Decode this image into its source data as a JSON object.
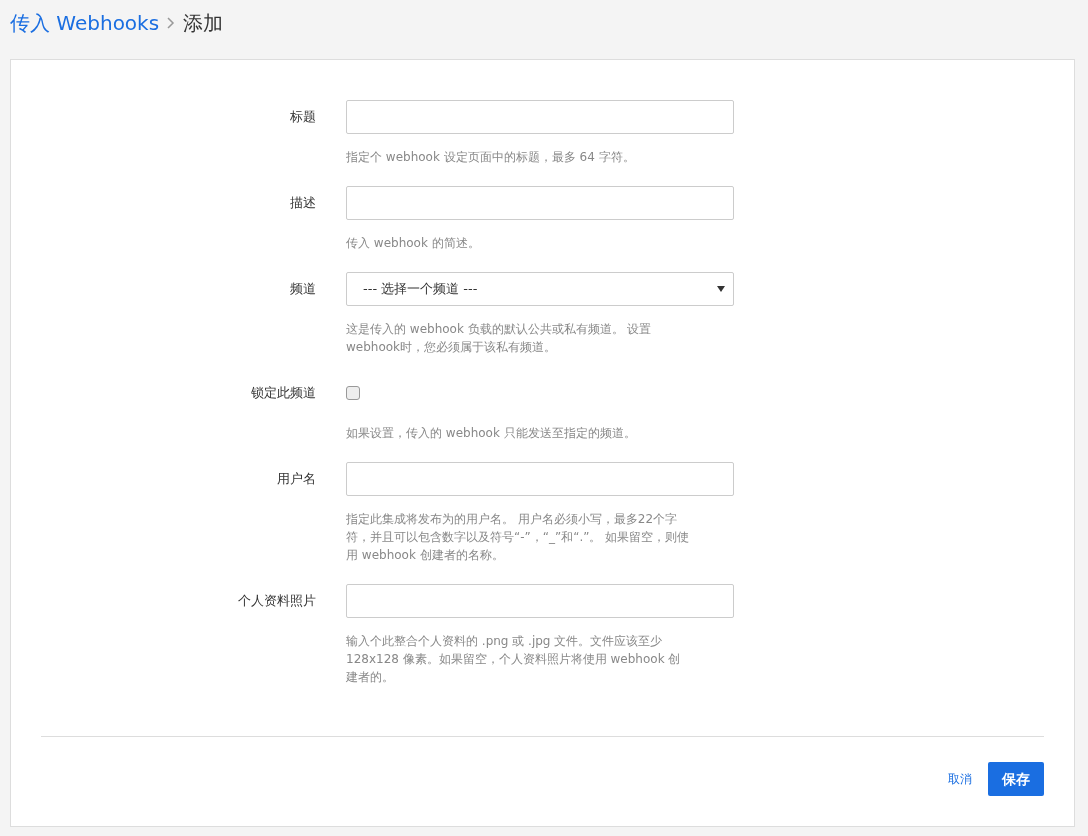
{
  "breadcrumb": {
    "parent": "传入 Webhooks",
    "current": "添加"
  },
  "fields": [
    {
      "kind": "input",
      "label": "标题",
      "help": "指定个 webhook 设定页面中的标题，最多 64 字符。"
    },
    {
      "kind": "input",
      "label": "描述",
      "help": "传入 webhook 的简述。"
    },
    {
      "kind": "select",
      "label": "频道",
      "value": "--- 选择一个频道 ---",
      "help": "这是传入的 webhook 负载的默认公共或私有频道。 设置 webhook时，您必须属于该私有频道。"
    },
    {
      "kind": "checkbox",
      "label": "锁定此频道",
      "checked": false,
      "help": "如果设置，传入的 webhook 只能发送至指定的频道。"
    },
    {
      "kind": "input",
      "label": "用户名",
      "help": "指定此集成将发布为的用户名。 用户名必须小写，最多22个字符，并且可以包含数字以及符号“-”，“_”和“.”。 如果留空，则使用 webhook 创建者的名称。"
    },
    {
      "kind": "input",
      "label": "个人资料照片",
      "help": "输入个此整合个人资料的 .png 或 .jpg 文件。文件应该至少 128x128 像素。如果留空，个人资料照片将使用 webhook 创建者的。"
    }
  ],
  "buttons": {
    "cancel": "取消",
    "save": "保存"
  }
}
